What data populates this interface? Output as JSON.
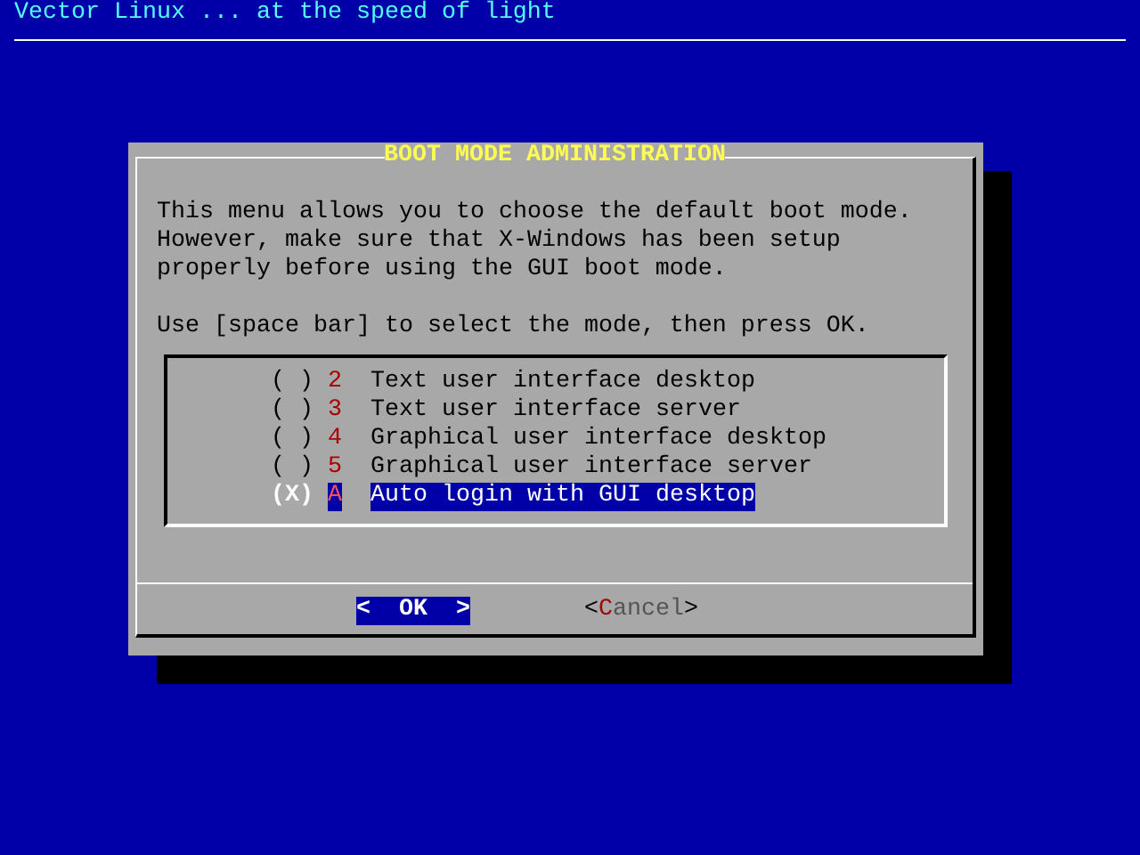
{
  "backtitle": "Vector Linux ... at the speed of light",
  "dialog": {
    "title": "BOOT MODE ADMINISTRATION",
    "message": [
      [
        "This menu allows you to choose the default boot mode.",
        "However, make sure that X-Windows has been setup",
        "properly before using the GUI boot mode."
      ],
      [
        "Use [space bar] to select the mode, then press OK."
      ]
    ],
    "items": [
      {
        "radio": "( )",
        "key": "2",
        "label": "Text user interface desktop",
        "checked": false,
        "selected": false
      },
      {
        "radio": "( )",
        "key": "3",
        "label": "Text user interface server",
        "checked": false,
        "selected": false
      },
      {
        "radio": "( )",
        "key": "4",
        "label": "Graphical user interface desktop",
        "checked": false,
        "selected": false
      },
      {
        "radio": "( )",
        "key": "5",
        "label": "Graphical user interface server",
        "checked": false,
        "selected": false
      },
      {
        "radio": "(X)",
        "key": "A",
        "label": "Auto login with GUI desktop",
        "checked": true,
        "selected": true
      }
    ],
    "buttons": [
      {
        "left": "<",
        "hotkey": "O",
        "rest": "K",
        "right": ">",
        "selected": true
      },
      {
        "left": "<",
        "hotkey": "C",
        "rest": "ancel",
        "right": ">",
        "selected": false
      }
    ]
  }
}
